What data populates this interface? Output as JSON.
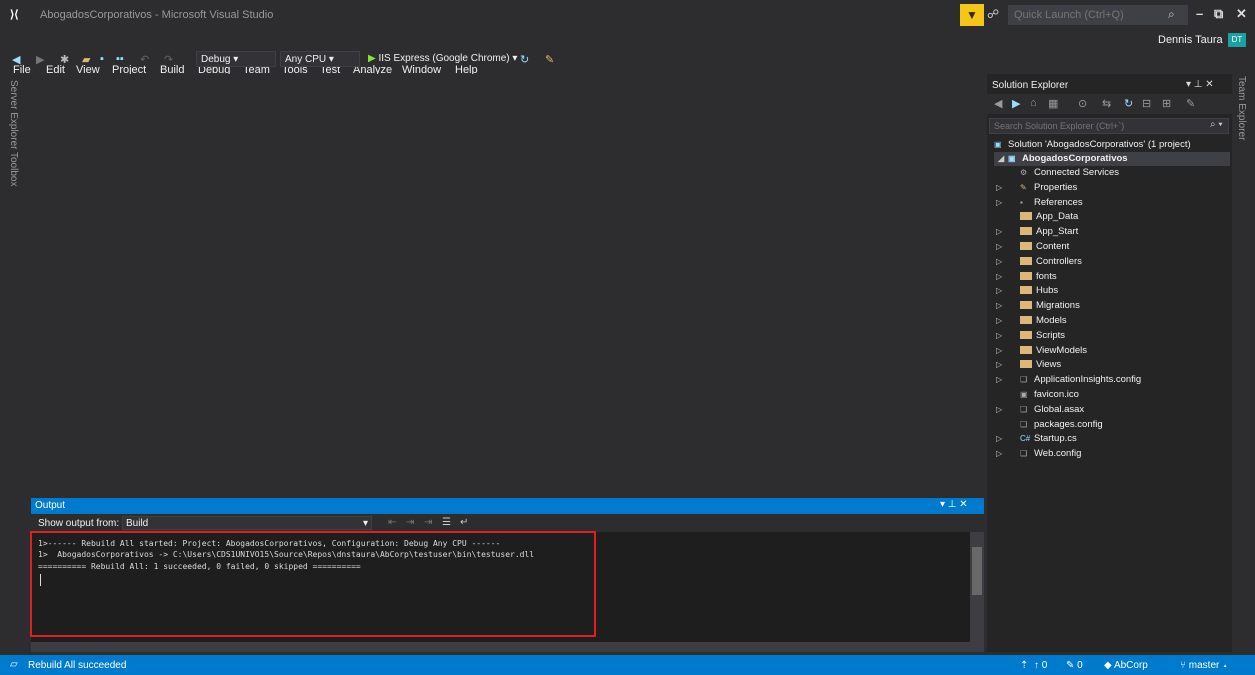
{
  "window": {
    "title": "AbogadosCorporativos - Microsoft Visual Studio",
    "quick_launch_placeholder": "Quick Launch (Ctrl+Q)",
    "user_name": "Dennis Taura",
    "user_initials": "DT"
  },
  "menu": [
    "File",
    "Edit",
    "View",
    "Project",
    "Build",
    "Debug",
    "Team",
    "Tools",
    "Test",
    "Analyze",
    "Window",
    "Help"
  ],
  "toolbar": {
    "configuration": "Debug",
    "platform": "Any CPU",
    "start_label": "IIS Express (Google Chrome)"
  },
  "side_tabs": {
    "left": [
      "Server Explorer",
      "Toolbox"
    ],
    "right": "Team Explorer"
  },
  "output": {
    "title": "Output",
    "show_output_from_label": "Show output from:",
    "source": "Build",
    "lines": [
      "1>------ Rebuild All started: Project: AbogadosCorporativos, Configuration: Debug Any CPU ------",
      "1>  AbogadosCorporativos -> C:\\Users\\CDS1UNIVO15\\Source\\Repos\\dnstaura\\AbCorp\\testuser\\bin\\testuser.dll",
      "========== Rebuild All: 1 succeeded, 0 failed, 0 skipped =========="
    ],
    "highlight_color": "#e02020"
  },
  "solution_explorer": {
    "title": "Solution Explorer",
    "search_placeholder": "Search Solution Explorer (Ctrl+`)",
    "solution_label": "Solution 'AbogadosCorporativos' (1 project)",
    "project_label": "AbogadosCorporativos",
    "items": [
      {
        "label": "Connected Services",
        "icon": "connected-services-icon",
        "expandable": false
      },
      {
        "label": "Properties",
        "icon": "wrench-icon",
        "expandable": true
      },
      {
        "label": "References",
        "icon": "references-icon",
        "expandable": true
      },
      {
        "label": "App_Data",
        "icon": "folder-icon",
        "expandable": false
      },
      {
        "label": "App_Start",
        "icon": "folder-icon",
        "expandable": true
      },
      {
        "label": "Content",
        "icon": "folder-icon",
        "expandable": true
      },
      {
        "label": "Controllers",
        "icon": "folder-icon",
        "expandable": true
      },
      {
        "label": "fonts",
        "icon": "folder-icon",
        "expandable": true
      },
      {
        "label": "Hubs",
        "icon": "folder-icon",
        "expandable": true
      },
      {
        "label": "Migrations",
        "icon": "folder-icon",
        "expandable": true
      },
      {
        "label": "Models",
        "icon": "folder-icon",
        "expandable": true
      },
      {
        "label": "Scripts",
        "icon": "folder-icon",
        "expandable": true
      },
      {
        "label": "ViewModels",
        "icon": "folder-icon",
        "expandable": true
      },
      {
        "label": "Views",
        "icon": "folder-icon",
        "expandable": true
      },
      {
        "label": "ApplicationInsights.config",
        "icon": "config-file-icon",
        "expandable": true
      },
      {
        "label": "favicon.ico",
        "icon": "image-file-icon",
        "expandable": false
      },
      {
        "label": "Global.asax",
        "icon": "asax-file-icon",
        "expandable": true
      },
      {
        "label": "packages.config",
        "icon": "config-file-icon",
        "expandable": false
      },
      {
        "label": "Startup.cs",
        "icon": "csharp-file-icon",
        "expandable": true
      },
      {
        "label": "Web.config",
        "icon": "config-file-icon",
        "expandable": true
      }
    ]
  },
  "status": {
    "text": "Rebuild All succeeded",
    "up_count": "0",
    "pencil_count": "0",
    "repo": "AbCorp",
    "branch": "master"
  },
  "colors": {
    "accent": "#007acc",
    "background": "#2d2d30",
    "highlight": "#e02020",
    "folder": "#dcb67a"
  }
}
